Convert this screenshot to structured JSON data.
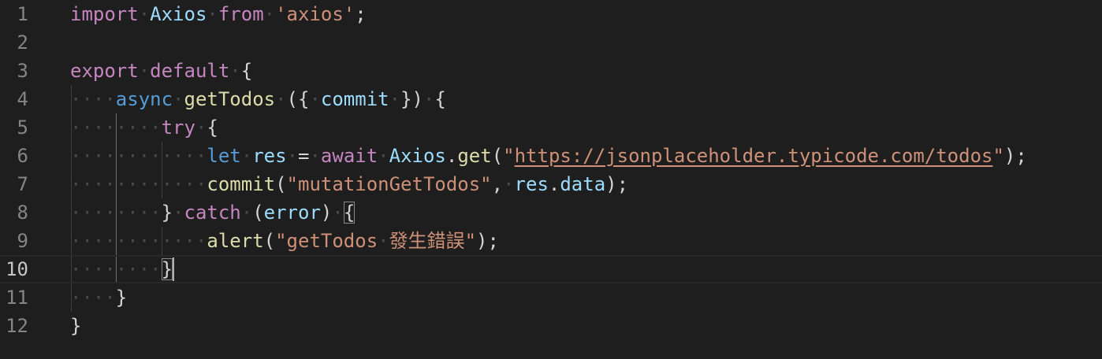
{
  "editor": {
    "lines": [
      {
        "number": "1",
        "tokens": [
          {
            "t": "import",
            "c": "kw"
          },
          {
            "t": "·",
            "c": "ws"
          },
          {
            "t": "Axios",
            "c": "var"
          },
          {
            "t": "·",
            "c": "ws"
          },
          {
            "t": "from",
            "c": "kw"
          },
          {
            "t": "·",
            "c": "ws"
          },
          {
            "t": "'axios'",
            "c": "str"
          },
          {
            "t": ";",
            "c": "punc"
          }
        ]
      },
      {
        "number": "2",
        "tokens": []
      },
      {
        "number": "3",
        "tokens": [
          {
            "t": "export",
            "c": "kw"
          },
          {
            "t": "·",
            "c": "ws"
          },
          {
            "t": "default",
            "c": "kw"
          },
          {
            "t": "·",
            "c": "ws"
          },
          {
            "t": "{",
            "c": "punc"
          }
        ]
      },
      {
        "number": "4",
        "tokens": [
          {
            "t": "····",
            "c": "ws"
          },
          {
            "t": "async",
            "c": "st"
          },
          {
            "t": "·",
            "c": "ws"
          },
          {
            "t": "getTodos",
            "c": "fn"
          },
          {
            "t": "·",
            "c": "ws"
          },
          {
            "t": "({",
            "c": "punc"
          },
          {
            "t": "·",
            "c": "ws"
          },
          {
            "t": "commit",
            "c": "var"
          },
          {
            "t": "·",
            "c": "ws"
          },
          {
            "t": "})",
            "c": "punc"
          },
          {
            "t": "·",
            "c": "ws"
          },
          {
            "t": "{",
            "c": "punc"
          }
        ]
      },
      {
        "number": "5",
        "tokens": [
          {
            "t": "········",
            "c": "ws"
          },
          {
            "t": "try",
            "c": "kw"
          },
          {
            "t": "·",
            "c": "ws"
          },
          {
            "t": "{",
            "c": "punc"
          }
        ]
      },
      {
        "number": "6",
        "tokens": [
          {
            "t": "············",
            "c": "ws"
          },
          {
            "t": "let",
            "c": "st"
          },
          {
            "t": "·",
            "c": "ws"
          },
          {
            "t": "res",
            "c": "var"
          },
          {
            "t": "·",
            "c": "ws"
          },
          {
            "t": "=",
            "c": "punc"
          },
          {
            "t": "·",
            "c": "ws"
          },
          {
            "t": "await",
            "c": "kw"
          },
          {
            "t": "·",
            "c": "ws"
          },
          {
            "t": "Axios",
            "c": "var"
          },
          {
            "t": ".",
            "c": "punc"
          },
          {
            "t": "get",
            "c": "fn"
          },
          {
            "t": "(",
            "c": "punc"
          },
          {
            "t": "\"",
            "c": "str"
          },
          {
            "t": "https://jsonplaceholder.typicode.com/todos",
            "c": "url"
          },
          {
            "t": "\"",
            "c": "str"
          },
          {
            "t": ");",
            "c": "punc"
          }
        ]
      },
      {
        "number": "7",
        "tokens": [
          {
            "t": "············",
            "c": "ws"
          },
          {
            "t": "commit",
            "c": "fn"
          },
          {
            "t": "(",
            "c": "punc"
          },
          {
            "t": "\"mutationGetTodos\"",
            "c": "str"
          },
          {
            "t": ",",
            "c": "punc"
          },
          {
            "t": "·",
            "c": "ws"
          },
          {
            "t": "res",
            "c": "var"
          },
          {
            "t": ".",
            "c": "punc"
          },
          {
            "t": "data",
            "c": "var"
          },
          {
            "t": ");",
            "c": "punc"
          }
        ]
      },
      {
        "number": "8",
        "tokens": [
          {
            "t": "········",
            "c": "ws"
          },
          {
            "t": "}",
            "c": "punc"
          },
          {
            "t": "·",
            "c": "ws"
          },
          {
            "t": "catch",
            "c": "kw"
          },
          {
            "t": "·",
            "c": "ws"
          },
          {
            "t": "(",
            "c": "punc"
          },
          {
            "t": "error",
            "c": "var"
          },
          {
            "t": ")",
            "c": "punc"
          },
          {
            "t": "·",
            "c": "ws"
          },
          {
            "t": "{",
            "c": "punc",
            "bm": true
          }
        ]
      },
      {
        "number": "9",
        "tokens": [
          {
            "t": "············",
            "c": "ws"
          },
          {
            "t": "alert",
            "c": "fn"
          },
          {
            "t": "(",
            "c": "punc"
          },
          {
            "t": "\"getTodos",
            "c": "str"
          },
          {
            "t": "·",
            "c": "ws"
          },
          {
            "t": "發生錯誤\"",
            "c": "str"
          },
          {
            "t": ");",
            "c": "punc"
          }
        ]
      },
      {
        "number": "10",
        "tokens": [
          {
            "t": "········",
            "c": "ws"
          },
          {
            "t": "}",
            "c": "punc",
            "bm": true
          }
        ],
        "current": true
      },
      {
        "number": "11",
        "tokens": [
          {
            "t": "····",
            "c": "ws"
          },
          {
            "t": "}",
            "c": "punc"
          }
        ]
      },
      {
        "number": "12",
        "tokens": [
          {
            "t": "}",
            "c": "punc"
          }
        ]
      }
    ]
  }
}
